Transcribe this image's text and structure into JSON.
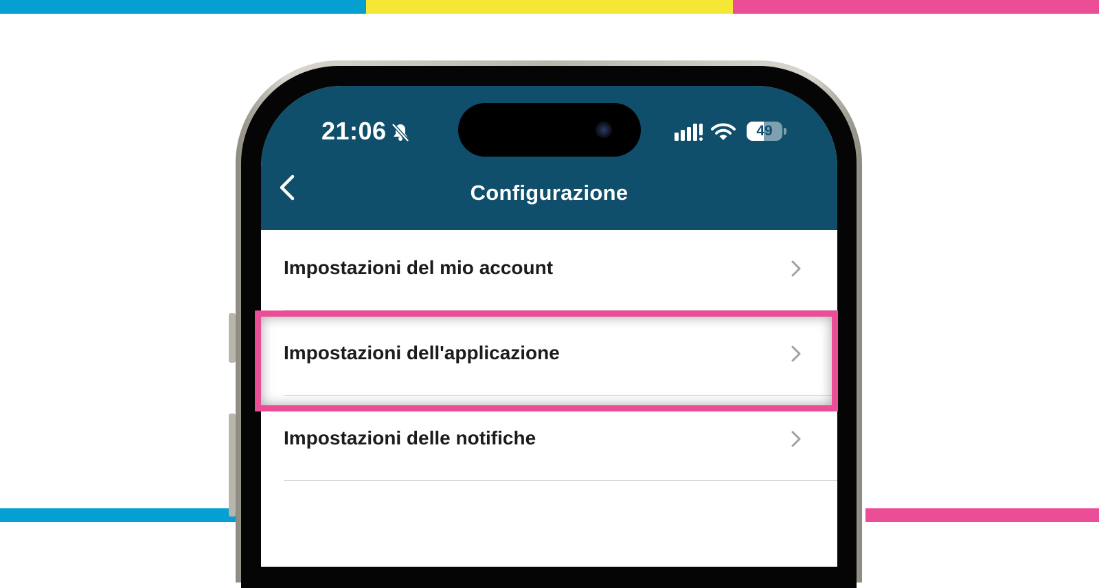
{
  "colors": {
    "band_blue": "#069fd2",
    "band_yellow": "#f5e735",
    "band_pink": "#ec4d97",
    "header_bg": "#0f4f6b",
    "highlight": "#ec4d97"
  },
  "status_bar": {
    "time": "21:06",
    "battery_level": "49",
    "battery_fraction": 0.49,
    "icons": [
      "bell-muted-icon",
      "signal-icon",
      "wifi-icon",
      "battery-icon"
    ]
  },
  "nav": {
    "title": "Configurazione",
    "back_icon": "chevron-left-icon"
  },
  "settings": {
    "items": [
      {
        "label": "Impostazioni del mio account",
        "icon": "chevron-right-icon"
      },
      {
        "label": "Impostazioni dell'applicazione",
        "icon": "chevron-right-icon",
        "highlighted": true
      },
      {
        "label": "Impostazioni delle notifiche",
        "icon": "chevron-right-icon"
      }
    ]
  }
}
